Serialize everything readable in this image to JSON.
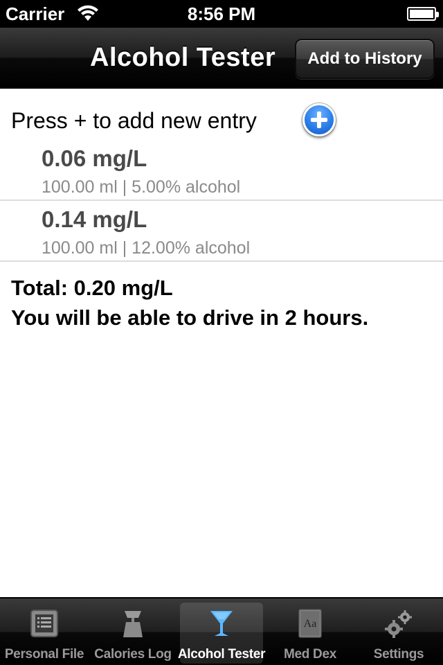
{
  "status_bar": {
    "carrier": "Carrier",
    "time": "8:56 PM"
  },
  "nav_bar": {
    "title": "Alcohol Tester",
    "add_history_label": "Add to History"
  },
  "content": {
    "add_prompt": "Press + to add new entry",
    "entries": [
      {
        "value": "0.06 mg/L",
        "detail": "100.00 ml | 5.00% alcohol"
      },
      {
        "value": "0.14 mg/L",
        "detail": "100.00 ml | 12.00% alcohol"
      }
    ],
    "total": "Total: 0.20 mg/L",
    "drive_message": "You will be able to drive in 2 hours."
  },
  "tab_bar": {
    "tabs": [
      {
        "label": "Personal File",
        "icon": "personal-file-icon",
        "selected": false
      },
      {
        "label": "Calories Log",
        "icon": "scale-icon",
        "selected": false
      },
      {
        "label": "Alcohol Tester",
        "icon": "cocktail-glass-icon",
        "selected": true
      },
      {
        "label": "Med Dex",
        "icon": "book-icon",
        "selected": false
      },
      {
        "label": "Settings",
        "icon": "gears-icon",
        "selected": false
      }
    ]
  },
  "colors": {
    "accent_blue": "#2a7ee8",
    "selected_tab_icon": "#5ab8ff"
  }
}
